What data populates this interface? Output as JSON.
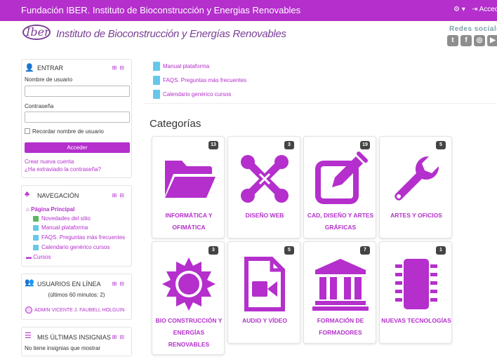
{
  "topbar": {
    "title": "Fundación IBER. Instituto de Bioconstrucción y Energias Renovables",
    "gear": "⚙ ▾",
    "login": "⇥ Acceder"
  },
  "header": {
    "logo_text": "Iber",
    "institution_name": "Instituto de Bioconstrucción y Energías Renovables",
    "social_title": "Redes sociales",
    "social_icons": [
      "twitter-icon",
      "facebook-icon",
      "instagram-icon",
      "youtube-icon"
    ]
  },
  "login_block": {
    "title": "Entrar",
    "username_label": "Nombre de usuario",
    "password_label": "Contraseña",
    "remember_label": "Recordar nombre de usuario",
    "submit": "Acceder",
    "create_account": "Crear nueva cuenta",
    "forgot_password": "¿Ha extraviado la contraseña?"
  },
  "nav_block": {
    "title": "Navegación",
    "home": "Página Principal",
    "items": [
      "Novedades del sitio",
      "Manual plataforma",
      "FAQS. Preguntas más frecuentes",
      "Calendario genérico cursos"
    ],
    "courses": "Cursos"
  },
  "users_block": {
    "title": "Usuarios en línea",
    "subtitle": "(últimos 60 minutos: 2)",
    "user": "ADMIN VICENTE J. FAUBELL HOLGUIN"
  },
  "badges_block": {
    "title": "Mis últimas insignias",
    "empty": "No tiene insignias que mostrar"
  },
  "main_links": [
    "Manual plataforma",
    "FAQS. Preguntas más frecuentes",
    "Calendario genérico cursos"
  ],
  "categories_heading": "Categorías",
  "categories": [
    {
      "label": "INFORMÁTICA y OFIMÁTICA",
      "count": "13",
      "icon": "folder-icon"
    },
    {
      "label": "DISEÑO WEB",
      "count": "3",
      "icon": "joomla-icon"
    },
    {
      "label": "CAD, DISEÑO Y ARTES GRÁFICAS",
      "count": "19",
      "icon": "edit-icon"
    },
    {
      "label": "ARTES Y OFICIOS",
      "count": "5",
      "icon": "wrench-icon"
    },
    {
      "label": "BIO CONSTRUCCIÓN Y ENERGÍAS RENOVABLES",
      "count": "3",
      "icon": "sun-icon"
    },
    {
      "label": "AUDIO Y VÍDEO",
      "count": "5",
      "icon": "video-file-icon"
    },
    {
      "label": "FORMACIÓN DE FORMADORES",
      "count": "7",
      "icon": "institution-icon"
    },
    {
      "label": "NUEVAS TECNOLOGÍAS",
      "count": "1",
      "icon": "microchip-icon"
    }
  ],
  "colors": {
    "accent": "#b42fcc",
    "link_icon": "#66c8e8",
    "badge": "#444444"
  }
}
